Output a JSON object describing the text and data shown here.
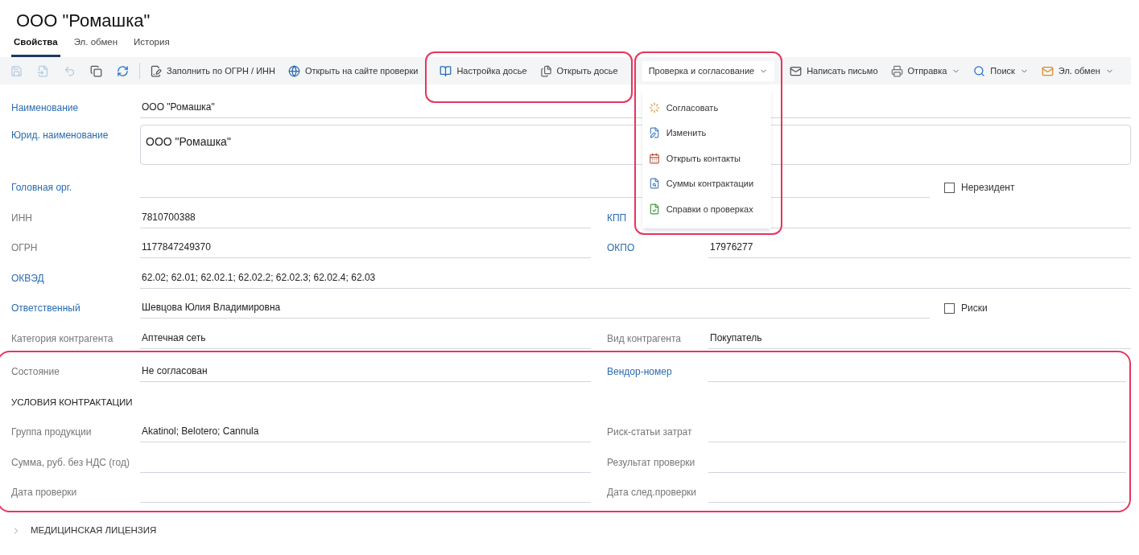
{
  "title": "ООО \"Ромашка\"",
  "tabs": [
    {
      "label": "Свойства",
      "selected": true
    },
    {
      "label": "Эл. обмен",
      "selected": false
    },
    {
      "label": "История",
      "selected": false
    }
  ],
  "toolbar": [
    {
      "annotated": false,
      "items": [
        {
          "kind": "icon",
          "disabled": true
        },
        {
          "kind": "icon",
          "disabled": true
        },
        {
          "kind": "icon",
          "disabled": true
        },
        {
          "kind": "icon",
          "disabled": false
        },
        {
          "kind": "icon",
          "disabled": false
        },
        {
          "kind": "separator"
        },
        {
          "kind": "button",
          "label": "Заполнить по ОГРН / ИНН",
          "dropdown": false
        },
        {
          "kind": "button",
          "label": "Открыть на сайте проверки",
          "dropdown": false
        }
      ]
    },
    {
      "annotated": true,
      "items": [
        {
          "kind": "button",
          "label": "Настройка досье",
          "dropdown": false
        },
        {
          "kind": "button",
          "label": "Открыть досье",
          "dropdown": false
        }
      ]
    },
    {
      "annotated": true,
      "items": [
        {
          "kind": "button",
          "label": "Проверка и согласование",
          "dropdown": true,
          "expanded": true,
          "menu": [
            {
              "label": "Согласовать"
            },
            {
              "label": "Изменить"
            },
            {
              "label": "Открыть контакты"
            },
            {
              "label": "Суммы контрактации"
            },
            {
              "label": "Справки о проверках"
            }
          ]
        }
      ]
    },
    {
      "annotated": false,
      "items": [
        {
          "kind": "button",
          "label": "Написать письмо",
          "dropdown": false
        },
        {
          "kind": "button",
          "label": "Отправка",
          "dropdown": true,
          "expanded": false
        },
        {
          "kind": "button",
          "label": "Поиск",
          "dropdown": true,
          "expanded": false
        },
        {
          "kind": "button",
          "label": "Эл. обмен",
          "dropdown": true,
          "expanded": false
        }
      ]
    }
  ],
  "sections": [
    {
      "annotated": false,
      "rows": [
        {
          "kind": "full",
          "label": "Наименование",
          "linked": true,
          "value": "ООО \"Ромашка\""
        },
        {
          "kind": "textarea",
          "label": "Юрид. наименование",
          "linked": true,
          "value": "ООО \"Ромашка\""
        },
        {
          "kind": "check",
          "label": "Головная орг.",
          "linked": true,
          "checkbox": {
            "label": "Нерезидент",
            "checked": false
          }
        },
        {
          "kind": "pair",
          "left": {
            "label": "ИНН",
            "linked": false,
            "value": "7810700388"
          },
          "right": {
            "label": "КПП",
            "linked": true
          }
        },
        {
          "kind": "pair",
          "left": {
            "label": "ОГРН",
            "linked": false,
            "value": "1177847249370"
          },
          "right": {
            "label": "ОКПО",
            "linked": true,
            "value": "17976277"
          }
        },
        {
          "kind": "full",
          "label": "ОКВЭД",
          "linked": true,
          "value": "62.02; 62.01; 62.02.1; 62.02.2; 62.02.3; 62.02.4; 62.03"
        },
        {
          "kind": "check",
          "label": "Ответственный",
          "linked": true,
          "value": "Шевцова Юлия Владимировна",
          "checkbox": {
            "label": "Риски",
            "checked": false
          }
        },
        {
          "kind": "pair",
          "left": {
            "label": "Категория контрагента",
            "linked": false,
            "value": "Аптечная сеть"
          },
          "right": {
            "label": "Вид контрагента",
            "linked": false,
            "value": "Покупатель"
          }
        }
      ]
    },
    {
      "annotated": true,
      "rows": [
        {
          "kind": "pair",
          "left": {
            "label": "Состояние",
            "linked": false,
            "value": "Не согласован"
          },
          "right": {
            "label": "Вендор-номер",
            "linked": true
          }
        },
        {
          "kind": "heading",
          "label": "УСЛОВИЯ КОНТРАКТАЦИИ"
        },
        {
          "kind": "pair",
          "left": {
            "label": "Группа продукции",
            "linked": false,
            "value": "Akatinol; Belotero; Cannula"
          },
          "right": {
            "label": "Риск-статьи затрат",
            "linked": false
          }
        },
        {
          "kind": "pair",
          "left": {
            "label": "Сумма, руб. без НДС (год)",
            "linked": false
          },
          "right": {
            "label": "Результат проверки",
            "linked": false
          }
        },
        {
          "kind": "pair",
          "left": {
            "label": "Дата проверки",
            "linked": false
          },
          "right": {
            "label": "Дата след.проверки",
            "linked": false
          }
        }
      ]
    }
  ],
  "collapsed_section": {
    "label": "МЕДИЦИНСКАЯ ЛИЦЕНЗИЯ",
    "expanded": false
  }
}
